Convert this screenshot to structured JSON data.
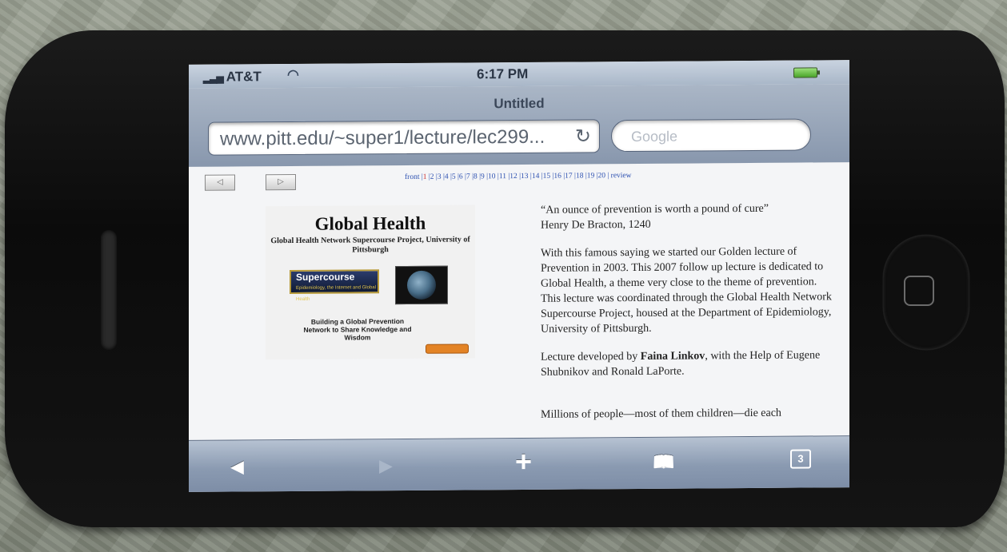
{
  "status": {
    "carrier": "AT&T",
    "time": "6:17 PM",
    "signal_icon": "signal-bars-icon",
    "wifi_icon": "wifi-icon",
    "battery_icon": "battery-icon"
  },
  "browser": {
    "title": "Untitled",
    "url": "www.pitt.edu/~super1/lecture/lec299...",
    "search_placeholder": "Google"
  },
  "page": {
    "nav_prev": "◁",
    "nav_next": "▷",
    "links_front": "front",
    "links": [
      "1",
      "2",
      "3",
      "4",
      "5",
      "6",
      "7",
      "8",
      "9",
      "10",
      "11",
      "12",
      "13",
      "14",
      "15",
      "16",
      "17",
      "18",
      "19",
      "20"
    ],
    "links_review": "review",
    "slide": {
      "title": "Global Health",
      "subtitle": "Global Health Network Supercourse Project, University of Pittsburgh",
      "logo_text": "Supercourse",
      "logo_sub": "Epidemiology, the Internet and Global Health",
      "tagline": "Building a Global Prevention Network to Share Knowledge and Wisdom"
    },
    "quote": "“An ounce of prevention is worth a pound of cure”",
    "quote_author": "Henry De Bracton, 1240",
    "para1": "With this famous saying we started our Golden lecture of Prevention in 2003. This 2007 follow up lecture is dedicated to Global Health,  a theme very close to the theme of prevention.",
    "para2": "This lecture was coordinated through the Global Health Network Supercourse Project, housed at the Department of Epidemiology, University of Pittsburgh.",
    "para3_pre": "Lecture developed by ",
    "para3_name": "Faina Linkov",
    "para3_post": ", with the Help of Eugene Shubnikov and Ronald LaPorte.",
    "para4": "Millions of people—most of them children—die each"
  },
  "toolbar": {
    "back": "◀",
    "forward": "▶",
    "add": "+",
    "bookmarks": "📖",
    "tabs_count": "3"
  }
}
